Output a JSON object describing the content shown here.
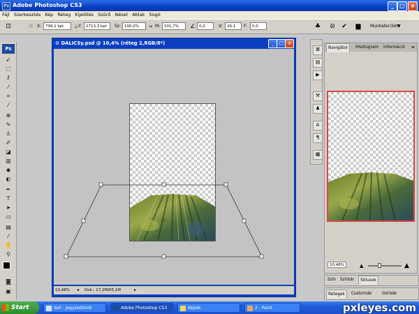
{
  "app": {
    "title": "Adobe Photoshop CS3",
    "logo": "Ps"
  },
  "window_controls": [
    "_",
    "□",
    "×"
  ],
  "menu": [
    "Fájl",
    "Szerkesztés",
    "Kép",
    "Réteg",
    "Kijelölés",
    "Szűrő",
    "Nézet",
    "Ablak",
    "Súgó"
  ],
  "options": {
    "x_label": "X:",
    "x_value": "799,1 kpt",
    "y_label": "Y:",
    "y_value": "2713,3 kpt",
    "w_label": "Sz:",
    "w_value": "100,0%",
    "h_label": "M:",
    "h_value": "101,7%",
    "angle_value": "0,0",
    "hskew_label": "V:",
    "hskew_value": "26,1",
    "vskew_label": "F:",
    "vskew_value": "0,0",
    "workspace": "Munkaterület"
  },
  "document": {
    "title": "DALICSy.psd @ 10,4% (réteg 2,RGB/8*)",
    "zoom": "10,48%",
    "doc_size": "Dok.: 17,2M/65,1M"
  },
  "navigator": {
    "tabs": [
      "Navigátor",
      "Hisztogram",
      "Információ"
    ],
    "zoom": "10,48%"
  },
  "panels": {
    "color_tabs": [
      "Szín",
      "Színtár",
      "Stílusok"
    ],
    "layer_tabs": [
      "Rétegek",
      "Csatornák",
      "Görbék"
    ]
  },
  "taskbar": {
    "start": "Start",
    "tasks": [
      "dali - Jegyzettömb",
      "Adobe Photoshop CS3",
      "Képek",
      "2 - Paint"
    ]
  },
  "watermark": "pxleyes.com",
  "colors": {
    "titlebar": "#0a3fc2",
    "taskbar": "#245edb",
    "start": "#2d8b2d",
    "nav_frame": "#d24b4b"
  }
}
